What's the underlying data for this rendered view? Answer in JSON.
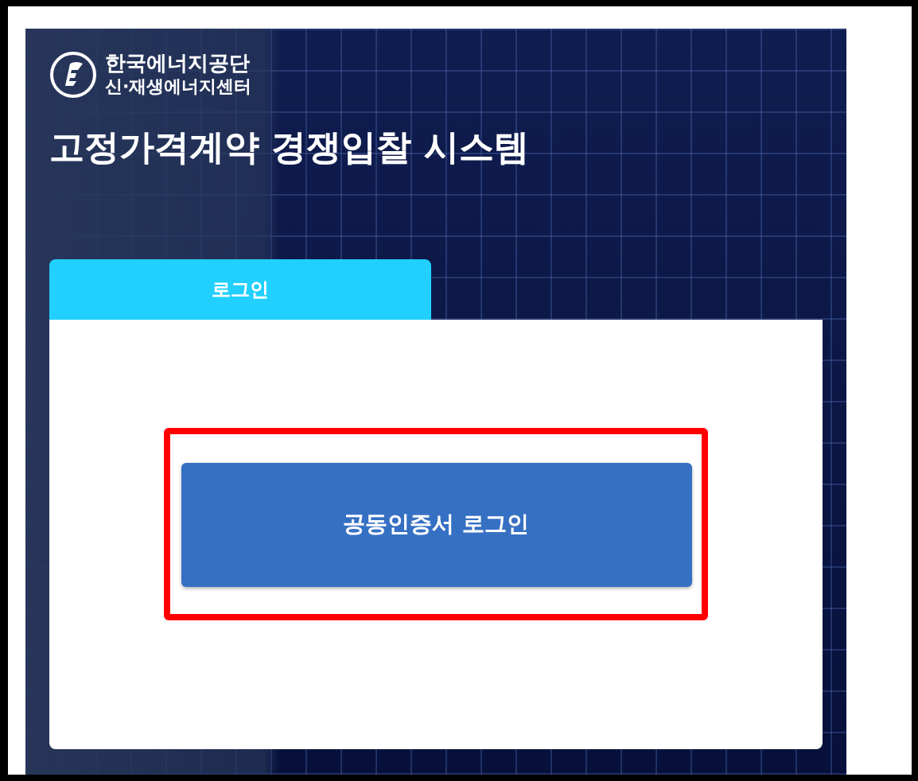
{
  "logo": {
    "name": "한국에너지공단",
    "subname": "신·재생에너지센터"
  },
  "title": "고정가격계약 경쟁입찰 시스템",
  "tabs": [
    {
      "label": "로그인",
      "selected": true
    }
  ],
  "login_button": {
    "label": "공동인증서 로그인",
    "highlighted": true
  }
}
